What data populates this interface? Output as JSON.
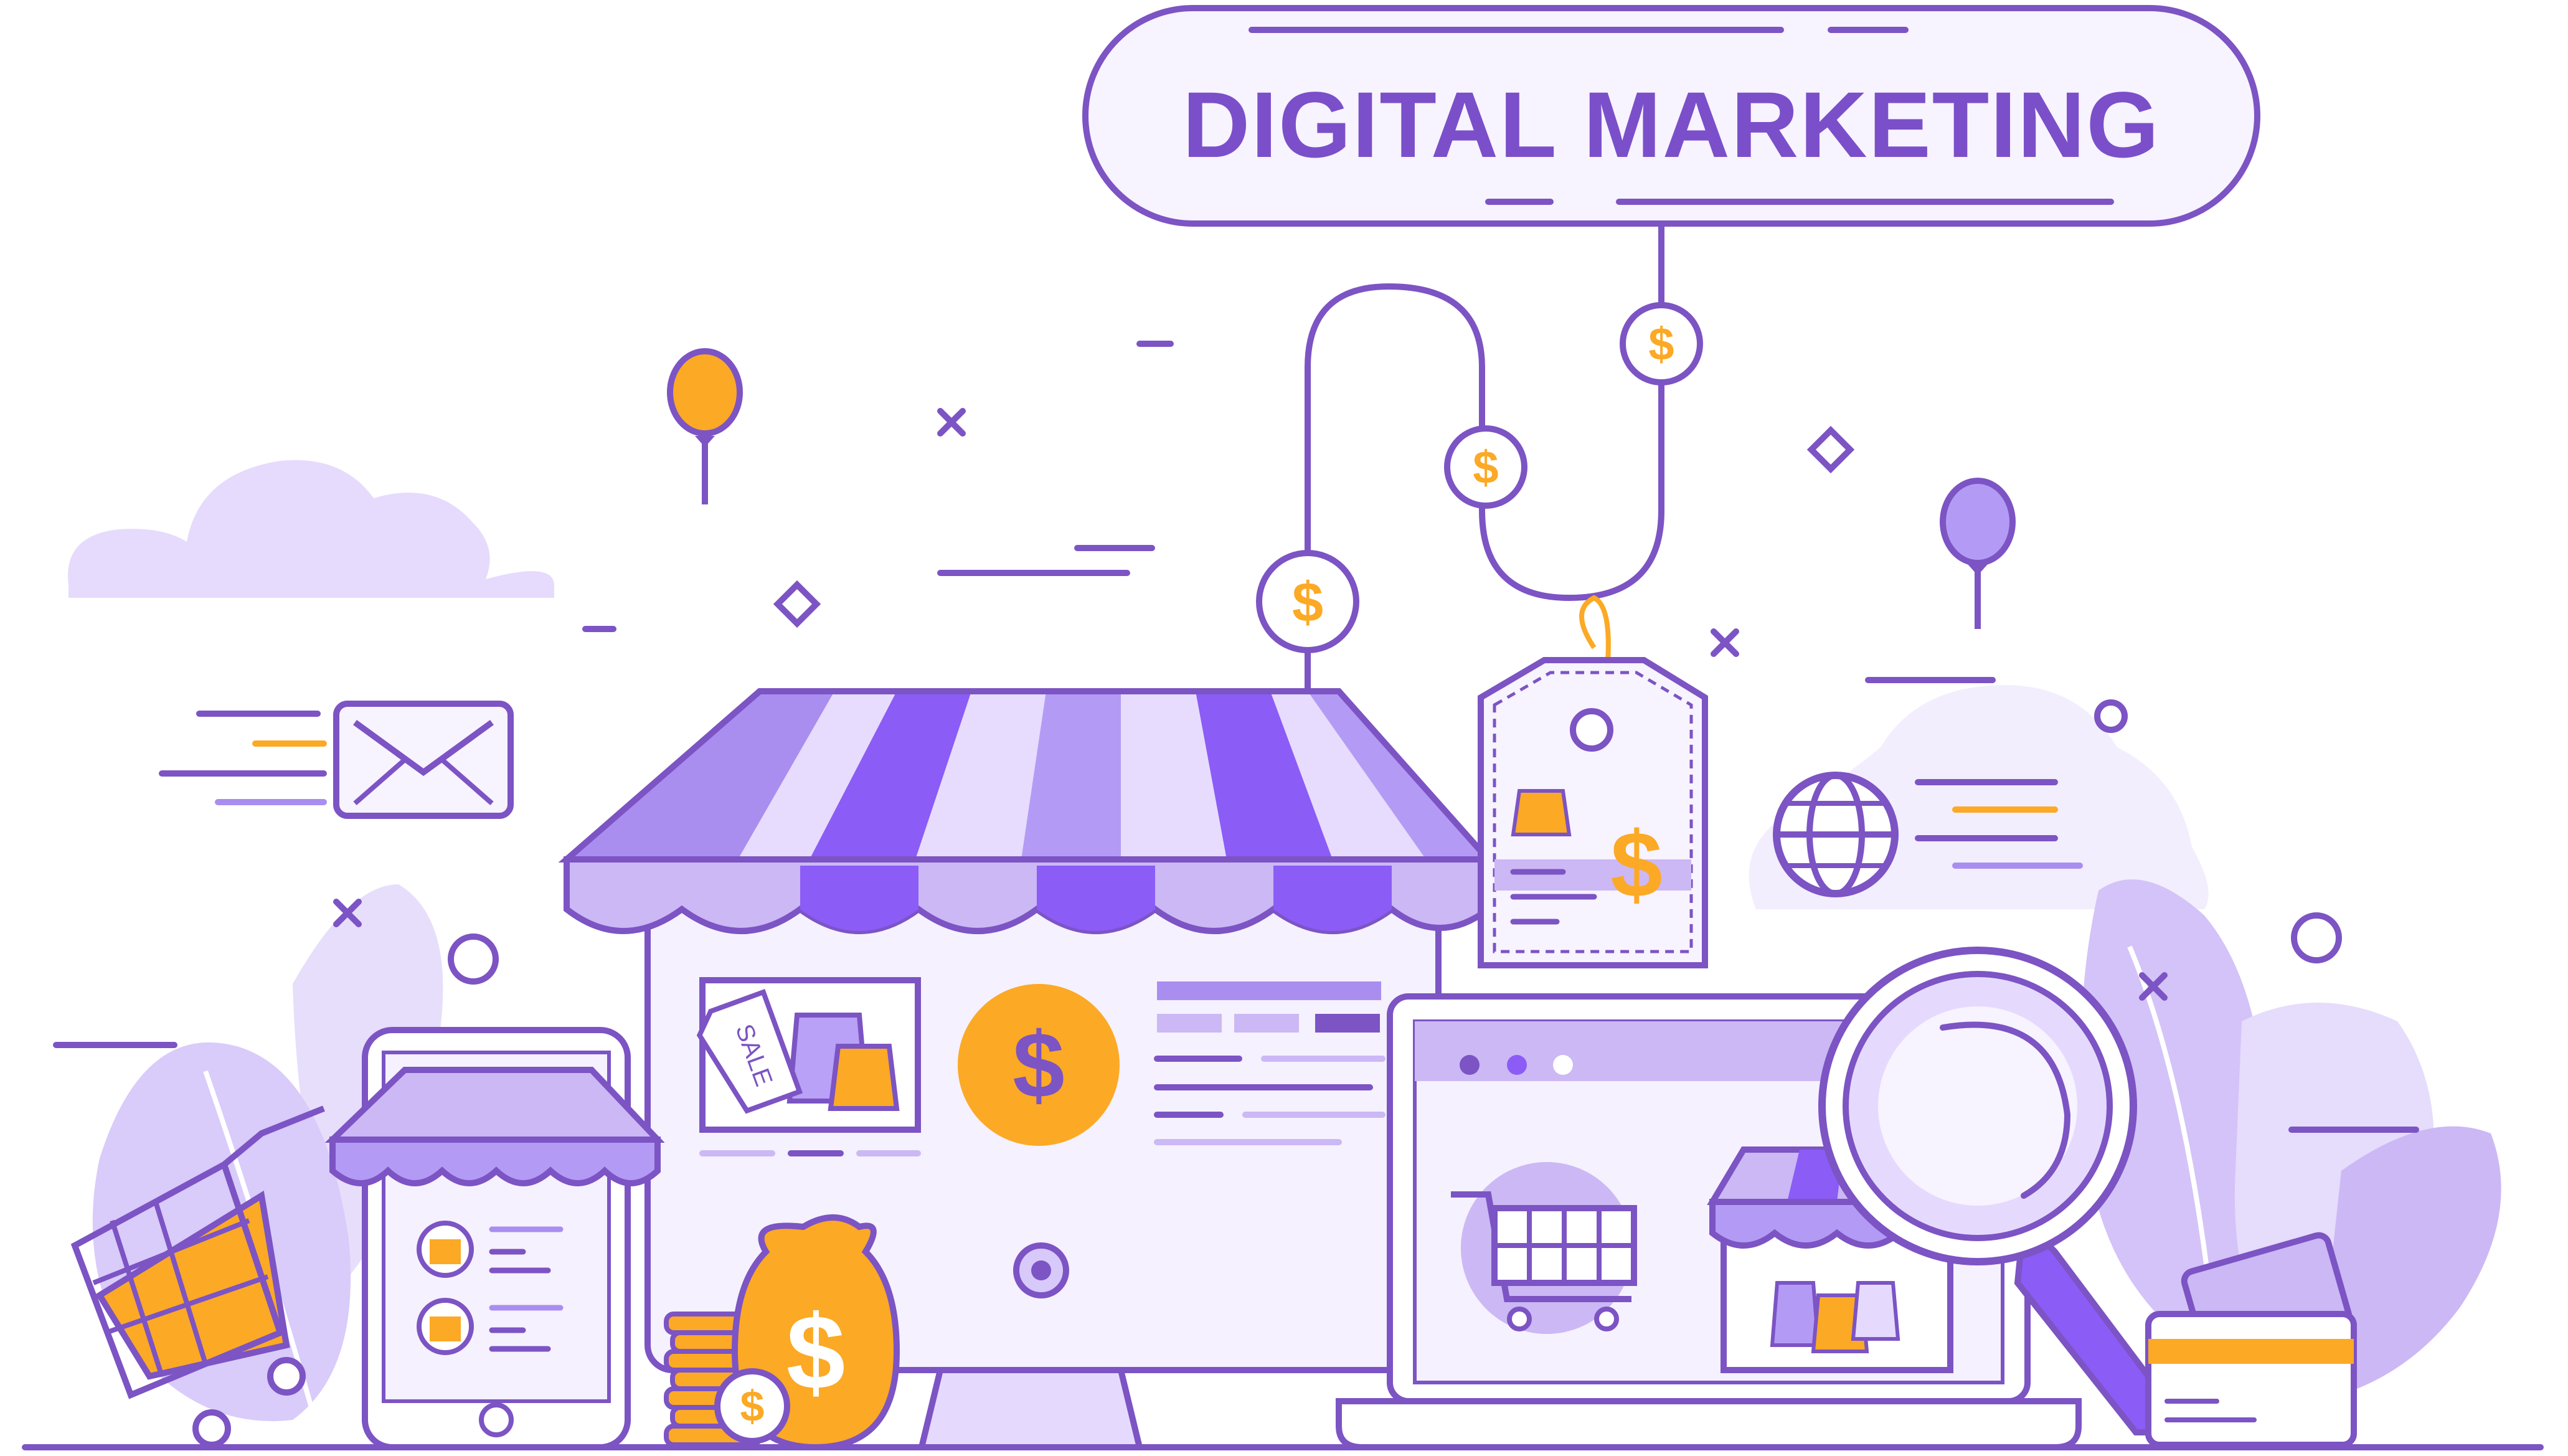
{
  "title": "DIGITAL MARKETING",
  "sale_tag_text": "SALE",
  "currency_symbol": "$",
  "colors": {
    "outline": "#7c54c4",
    "purple_dark": "#8b5cf6",
    "purple_mid": "#a98ef0",
    "purple_light": "#cbb8f5",
    "purple_pale": "#ece5fd",
    "orange": "#fca925",
    "white": "#ffffff"
  },
  "icons": [
    "cloud-icon",
    "balloon-icon",
    "envelope-icon",
    "globe-icon",
    "shop-icon",
    "price-tag-icon",
    "coin-icon",
    "money-bag-icon",
    "shopping-cart-icon",
    "magnifier-icon",
    "credit-card-icon",
    "smartphone-icon",
    "laptop-icon",
    "monitor-icon",
    "shopping-bag-icon",
    "leaf-icon"
  ]
}
